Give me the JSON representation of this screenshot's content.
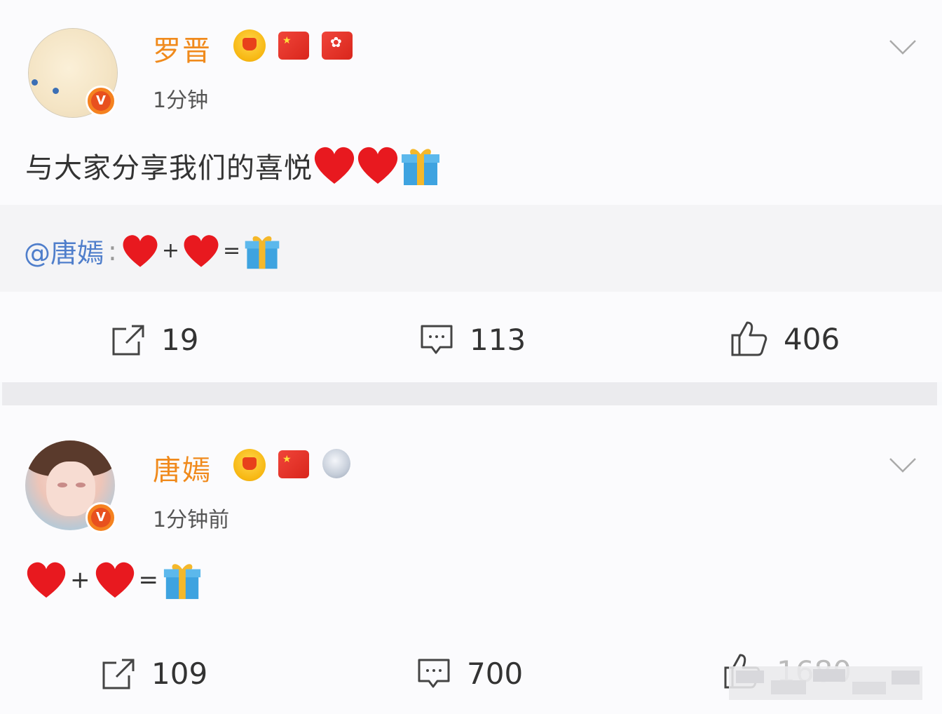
{
  "posts": [
    {
      "username": "罗晋",
      "timestamp": "1分钟",
      "verified_badge": "V",
      "badges": [
        "crown-icon",
        "china-flag-icon",
        "hongkong-flag-icon"
      ],
      "text": "与大家分享我们的喜悦",
      "text_emojis": [
        "heart",
        "heart",
        "gift"
      ],
      "repost": {
        "mention": "@唐嫣",
        "colon": ":",
        "plus": "+",
        "equals": "="
      },
      "actions": {
        "repost": "19",
        "comment": "113",
        "like": "406"
      }
    },
    {
      "username": "唐嫣",
      "timestamp": "1分钟前",
      "verified_badge": "V",
      "badges": [
        "crown-icon",
        "china-flag-icon",
        "silver-medal-icon"
      ],
      "plus": "+",
      "equals": "=",
      "actions": {
        "repost": "109",
        "comment": "700",
        "like": "1680"
      }
    }
  ],
  "colors": {
    "username": "#f08a1c",
    "mention": "#4f7ecb",
    "verified": "#f58220",
    "heart": "#e8191f",
    "gift_box": "#3ea3e0",
    "gift_ribbon": "#f5b82a"
  }
}
